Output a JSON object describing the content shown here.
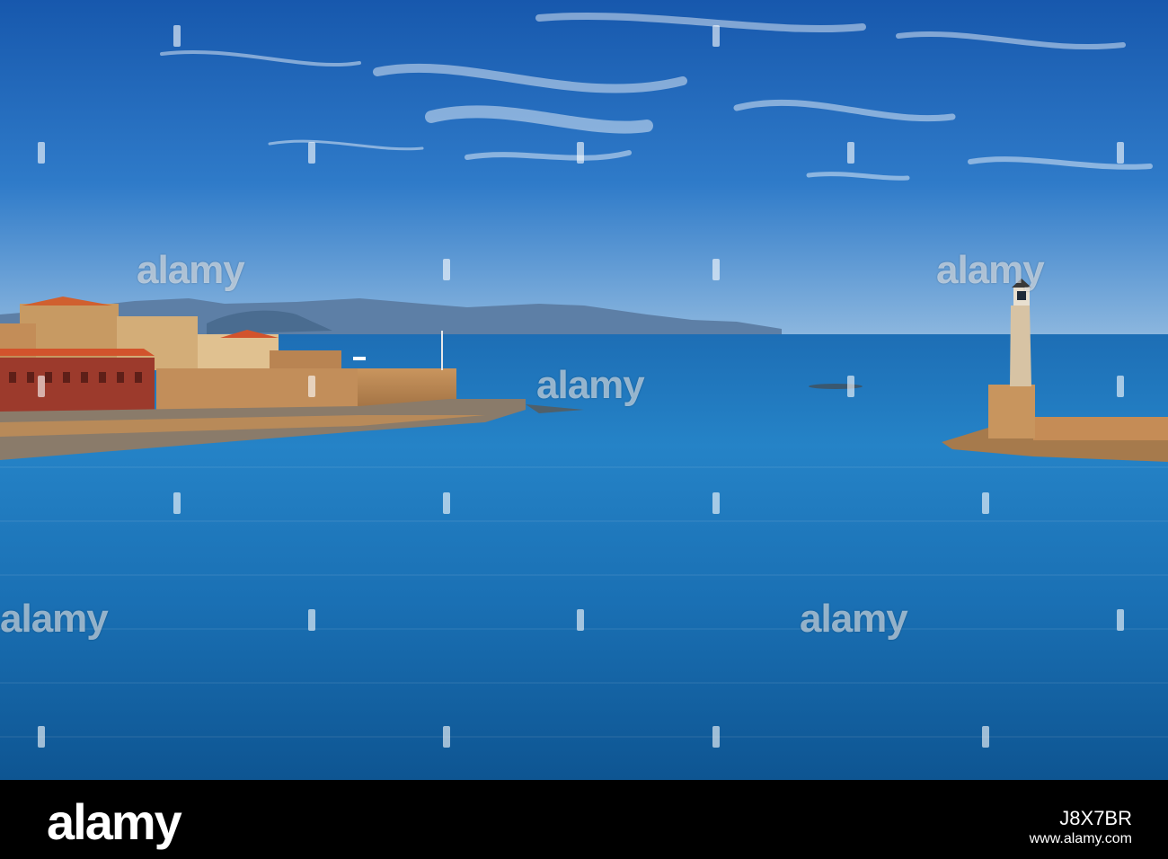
{
  "watermark": {
    "text": "alamy"
  },
  "footer": {
    "logo": "alamy",
    "caption": "",
    "image_id": "J8X7BR",
    "url": "www.alamy.com"
  },
  "colors": {
    "sky_top": "#1a62b4",
    "sky_horizon": "#8fb8e0",
    "sea_deep": "#0f5e9e",
    "sea_bright": "#2b8ed0",
    "stone": "#c9935a",
    "roof": "#d2532c",
    "footer_bg": "#000000"
  }
}
